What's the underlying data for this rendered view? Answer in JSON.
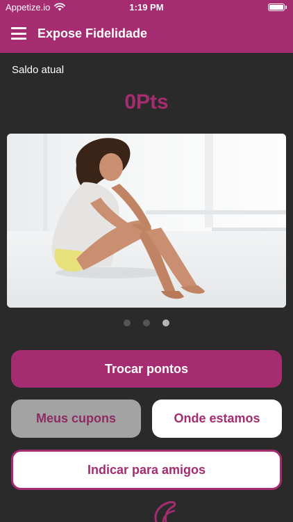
{
  "status_bar": {
    "carrier": "Appetize.io",
    "time": "1:19 PM"
  },
  "app_bar": {
    "title": "Expose Fidelidade",
    "menu_icon": "hamburger-menu-icon"
  },
  "balance": {
    "label": "Saldo atual",
    "value": "0Pts"
  },
  "carousel": {
    "slide_count": 3,
    "active_index": 2,
    "image": "woman-applying-lotion-on-legs"
  },
  "buttons": {
    "exchange_points": "Trocar pontos",
    "my_coupons": "Meus cupons",
    "where_we_are": "Onde estamos",
    "refer_friends": "Indicar para amigos"
  },
  "colors": {
    "brand": "#a52c70",
    "background": "#2b2a2b",
    "grey_button": "#a3a3a3"
  }
}
